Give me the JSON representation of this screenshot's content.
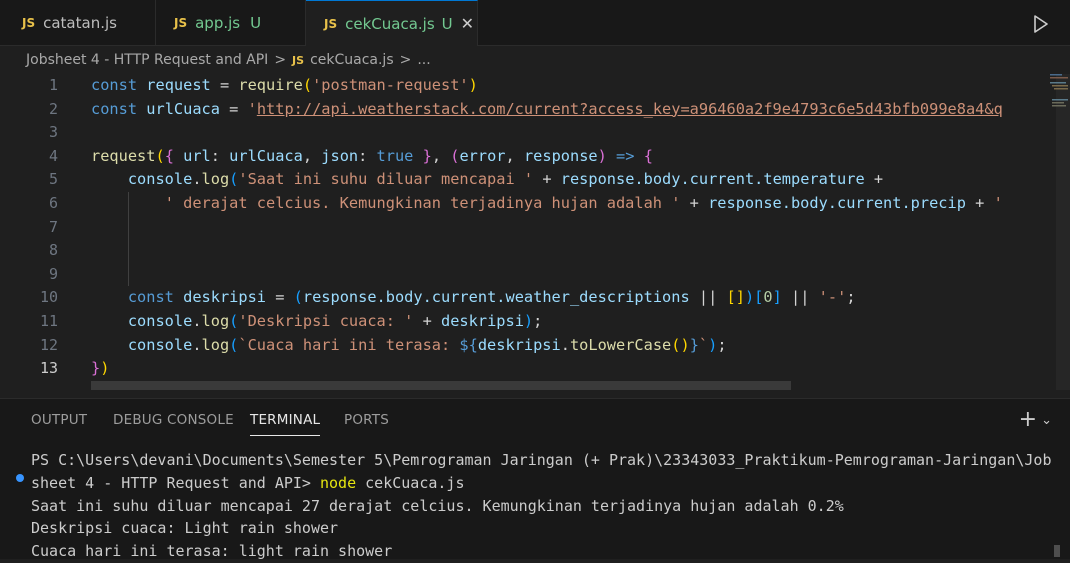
{
  "tabs": [
    {
      "icon": "JS",
      "label": "catatan.js",
      "status": ""
    },
    {
      "icon": "JS",
      "label": "app.js",
      "status": "U"
    },
    {
      "icon": "JS",
      "label": "cekCuaca.js",
      "status": "U",
      "close": "✕"
    }
  ],
  "breadcrumb": {
    "folder": "Jobsheet 4 - HTTP Request and API",
    "sep": ">",
    "icon": "JS",
    "file": "cekCuaca.js",
    "more": "..."
  },
  "editor": {
    "line_numbers": [
      "1",
      "2",
      "3",
      "4",
      "5",
      "6",
      "7",
      "8",
      "9",
      "10",
      "11",
      "12",
      "13"
    ],
    "current_line": "13",
    "lines": {
      "l1": {
        "kw": "const",
        "name": " request",
        "eq": " = ",
        "fn": "require",
        "p1": "(",
        "str": "'postman-request'",
        "p2": ")"
      },
      "l2": {
        "kw": "const",
        "name": " urlCuaca",
        "eq": " = ",
        "q": "'",
        "url": "http://api.weatherstack.com/current?access_key=a96460a2f9e4793c6e5d43bfb099e8a4&q"
      },
      "l4": {
        "fn": "request",
        "p1": "(",
        "p2": "{",
        "k1": " url",
        "c1": ": ",
        "v1": "urlCuaca",
        "c2": ", ",
        "k2": "json",
        "c3": ": ",
        "v2": "true",
        "p3": " }",
        "c4": ", ",
        "p4": "(",
        "a1": "error",
        "c5": ", ",
        "a2": "response",
        "p5": ")",
        "arrow": " => ",
        "p6": "{"
      },
      "l5": {
        "indent": "    ",
        "obj": "console",
        "dot": ".",
        "fn": "log",
        "p1": "(",
        "str": "'Saat ini suhu diluar mencapai '",
        "plus": " + ",
        "v": "response.body.current.temperature",
        "plus2": " +"
      },
      "l6": {
        "indent": "        ",
        "str": "' derajat celcius. Kemungkinan terjadinya hujan adalah '",
        "plus": " + ",
        "v": "response.body.current.precip",
        "plus2": " + ",
        "str2": "'"
      },
      "l10": {
        "indent": "    ",
        "kw": "const",
        "name": " deskripsi",
        "eq": " = ",
        "p1": "(",
        "v": "response.body.current.weather_descriptions",
        "or": " || ",
        "p2": "[]",
        "p3": ")",
        "p4": "[",
        "num": "0",
        "p5": "]",
        "or2": " || ",
        "str": "'-'",
        "semi": ";"
      },
      "l11": {
        "indent": "    ",
        "obj": "console",
        "dot": ".",
        "fn": "log",
        "p1": "(",
        "str": "'Deskripsi cuaca: '",
        "plus": " + ",
        "v": "deskripsi",
        "p2": ")",
        "semi": ";"
      },
      "l12": {
        "indent": "    ",
        "obj": "console",
        "dot": ".",
        "fn": "log",
        "p1": "(",
        "str": "`Cuaca hari ini terasa: ",
        "tpl1": "${",
        "v": "deskripsi",
        "fn2": "toLowerCase",
        "p2": "()",
        "tpl2": "}",
        "str2": "`",
        "p3": ")",
        "semi": ";"
      },
      "l13": {
        "p1": "}",
        "p2": ")"
      }
    }
  },
  "panel": {
    "tabs": [
      "OUTPUT",
      "DEBUG CONSOLE",
      "TERMINAL",
      "PORTS"
    ],
    "active_tab": "TERMINAL",
    "add_label": "+",
    "chevron": "⌄",
    "terminal": {
      "line1": "PS C:\\Users\\devani\\Documents\\Semester 5\\Pemrograman Jaringan (+ Prak)\\23343033_Praktikum-Pemrograman-Jaringan\\Job",
      "line2_prefix": "sheet 4 - HTTP Request and API> ",
      "line2_cmd": "node",
      "line2_arg": " cekCuaca.js",
      "line3": "Saat ini suhu diluar mencapai 27 derajat celcius. Kemungkinan terjadinya hujan adalah 0.2%",
      "line4": "Deskripsi cuaca: Light rain shower",
      "line5": "Cuaca hari ini terasa: light rain shower"
    }
  },
  "colors": {
    "accent": "#0078d4",
    "untracked": "#73c991",
    "js_icon": "#e8c14a"
  }
}
